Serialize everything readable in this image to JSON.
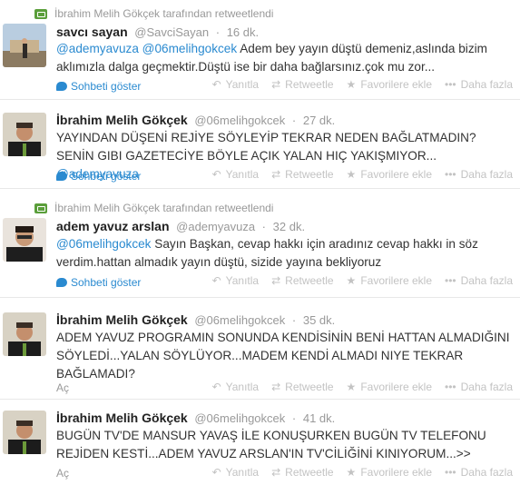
{
  "actions": {
    "reply": "Yanıtla",
    "retweet": "Retweetle",
    "favorite": "Favorilere ekle",
    "more": "Daha fazla"
  },
  "tweets": [
    {
      "retweeted_by": "İbrahim Melih Gökçek tarafından retweetlendi",
      "name": "savcı sayan",
      "handle": "@SavciSayan",
      "sep": "·",
      "time": "16 dk.",
      "mention1": "@ademyavuza",
      "mention2": "@06melihgokcek",
      "text": "Adem bey yayın düştü demeniz,aslında bizim aklımızla dalga geçmektir.Düştü ise bir daha bağlarsınız.çok mu zor...",
      "footer": "Sohbeti göster"
    },
    {
      "name": "İbrahim Melih Gökçek",
      "handle": "@06melihgokcek",
      "sep": "·",
      "time": "27 dk.",
      "text": "YAYINDAN DÜŞENİ REJİYE SÖYLEYİP TEKRAR NEDEN BAĞLATMADIN? SENİN GIBI GAZETECİYE BÖYLE AÇIK YALAN HIÇ YAKIŞMIYOR...",
      "mention1": "@ademyavuza",
      "footer": "Sohbeti göster"
    },
    {
      "retweeted_by": "İbrahim Melih Gökçek tarafından retweetlendi",
      "name": "adem yavuz arslan",
      "handle": "@ademyavuza",
      "sep": "·",
      "time": "32 dk.",
      "mention1": "@06melihgokcek",
      "text": "Sayın Başkan, cevap hakkı için aradınız cevap hakkı in söz verdim.hattan almadık yayın düştü, sizide yayına bekliyoruz",
      "footer": "Sohbeti göster"
    },
    {
      "name": "İbrahim Melih Gökçek",
      "handle": "@06melihgokcek",
      "sep": "·",
      "time": "35 dk.",
      "text": "ADEM YAVUZ PROGRAMIN SONUNDA KENDİSİNİN BENİ HATTAN ALMADIĞINI SÖYLEDİ...YALAN SÖYLÜYOR...MADEM KENDİ ALMADI NIYE TEKRAR BAĞLAMADI?",
      "footer": "Aç"
    },
    {
      "name": "İbrahim Melih Gökçek",
      "handle": "@06melihgokcek",
      "sep": "·",
      "time": "41 dk.",
      "text": "BUGÜN TV'DE MANSUR YAVAŞ İLE  KONUŞURKEN BUGÜN TV TELEFONU REJİDEN KESTİ...ADEM YAVUZ ARSLAN'IN TV'CİLİĞİNİ KINIYORUM...>>",
      "footer": "Aç"
    }
  ]
}
